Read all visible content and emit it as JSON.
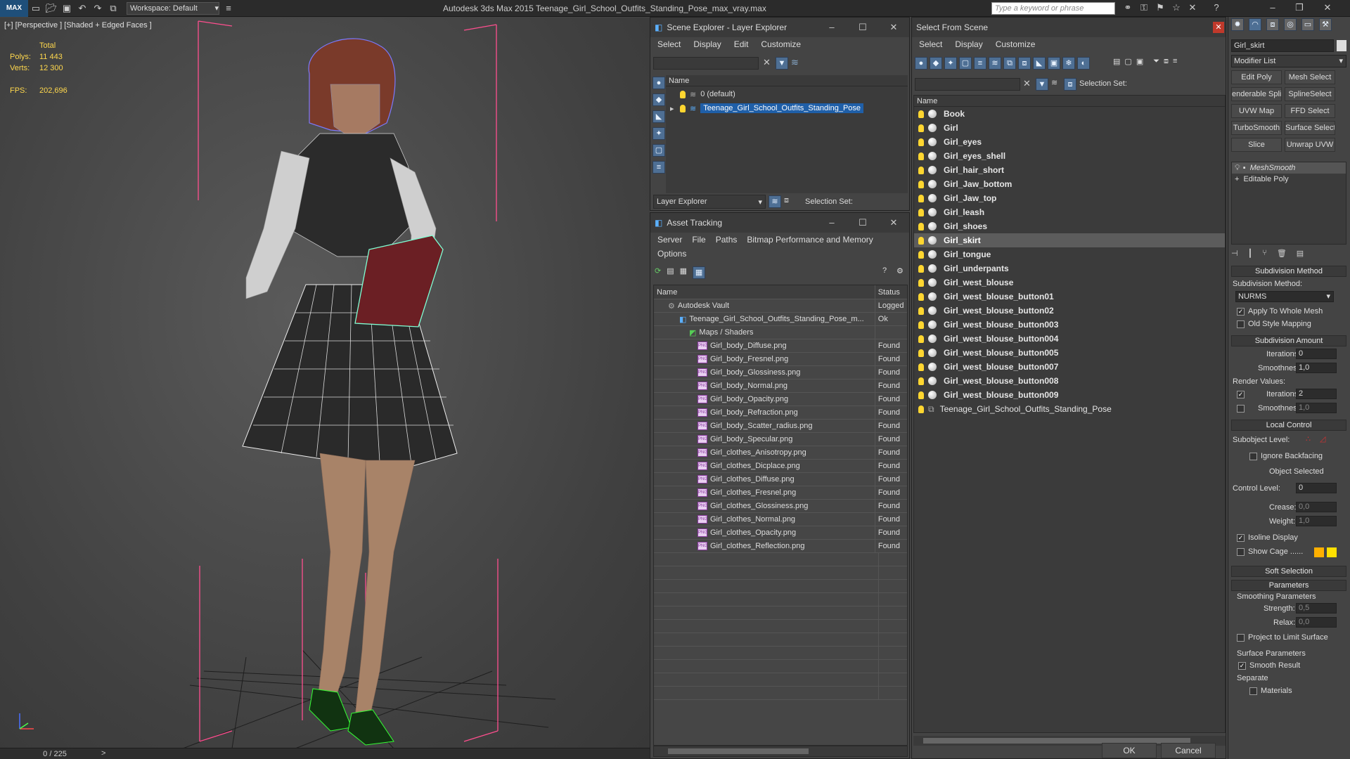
{
  "app": {
    "title": "Autodesk 3ds Max  2015     Teenage_Girl_School_Outfits_Standing_Pose_max_vray.max",
    "logo": "MAX",
    "workspace": "Workspace: Default",
    "search_placeholder": "Type a keyword or phrase"
  },
  "viewport": {
    "label": "[+] [Perspective ] [Shaded + Edged Faces ]",
    "stats": {
      "total_label": "Total",
      "polys_label": "Polys:",
      "polys": "11 443",
      "verts_label": "Verts:",
      "verts": "12 300",
      "fps_label": "FPS:",
      "fps": "202,696"
    },
    "frame": "0 / 225",
    "axis_labels": {
      "x": "x",
      "y": "y",
      "z": "z"
    }
  },
  "scene_explorer": {
    "title": "Scene Explorer - Layer Explorer",
    "menu": [
      "Select",
      "Display",
      "Edit",
      "Customize"
    ],
    "col_name": "Name",
    "items": [
      "0 (default)",
      "Teenage_Girl_School_Outfits_Standing_Pose"
    ],
    "footer_dropdown": "Layer Explorer",
    "selection_set": "Selection Set:"
  },
  "asset_tracking": {
    "title": "Asset Tracking",
    "menu": [
      "Server",
      "File",
      "Paths",
      "Bitmap Performance and Memory"
    ],
    "menu2": "Options",
    "col_name": "Name",
    "col_status": "Status",
    "rows": [
      {
        "name": "Autodesk Vault",
        "status": "Logged",
        "level": 1,
        "kind": "vault"
      },
      {
        "name": "Teenage_Girl_School_Outfits_Standing_Pose_m...",
        "status": "Ok",
        "level": 2,
        "kind": "file"
      },
      {
        "name": "Maps / Shaders",
        "status": "",
        "level": 3,
        "kind": "maps"
      },
      {
        "name": "Girl_body_Diffuse.png",
        "status": "Found",
        "level": 4,
        "kind": "png"
      },
      {
        "name": "Girl_body_Fresnel.png",
        "status": "Found",
        "level": 4,
        "kind": "png"
      },
      {
        "name": "Girl_body_Glossiness.png",
        "status": "Found",
        "level": 4,
        "kind": "png"
      },
      {
        "name": "Girl_body_Normal.png",
        "status": "Found",
        "level": 4,
        "kind": "png"
      },
      {
        "name": "Girl_body_Opacity.png",
        "status": "Found",
        "level": 4,
        "kind": "png"
      },
      {
        "name": "Girl_body_Refraction.png",
        "status": "Found",
        "level": 4,
        "kind": "png"
      },
      {
        "name": "Girl_body_Scatter_radius.png",
        "status": "Found",
        "level": 4,
        "kind": "png"
      },
      {
        "name": "Girl_body_Specular.png",
        "status": "Found",
        "level": 4,
        "kind": "png"
      },
      {
        "name": "Girl_clothes_Anisotropy.png",
        "status": "Found",
        "level": 4,
        "kind": "png"
      },
      {
        "name": "Girl_clothes_Dicplace.png",
        "status": "Found",
        "level": 4,
        "kind": "png"
      },
      {
        "name": "Girl_clothes_Diffuse.png",
        "status": "Found",
        "level": 4,
        "kind": "png"
      },
      {
        "name": "Girl_clothes_Fresnel.png",
        "status": "Found",
        "level": 4,
        "kind": "png"
      },
      {
        "name": "Girl_clothes_Glossiness.png",
        "status": "Found",
        "level": 4,
        "kind": "png"
      },
      {
        "name": "Girl_clothes_Normal.png",
        "status": "Found",
        "level": 4,
        "kind": "png"
      },
      {
        "name": "Girl_clothes_Opacity.png",
        "status": "Found",
        "level": 4,
        "kind": "png"
      },
      {
        "name": "Girl_clothes_Reflection.png",
        "status": "Found",
        "level": 4,
        "kind": "png"
      }
    ]
  },
  "select_from_scene": {
    "title": "Select From Scene",
    "menu": [
      "Select",
      "Display",
      "Customize"
    ],
    "selection_set": "Selection Set:",
    "col_name": "Name",
    "items": [
      "Book",
      "Girl",
      "Girl_eyes",
      "Girl_eyes_shell",
      "Girl_hair_short",
      "Girl_Jaw_bottom",
      "Girl_Jaw_top",
      "Girl_leash",
      "Girl_shoes",
      "Girl_skirt",
      "Girl_tongue",
      "Girl_underpants",
      "Girl_west_blouse",
      "Girl_west_blouse_button01",
      "Girl_west_blouse_button02",
      "Girl_west_blouse_button003",
      "Girl_west_blouse_button004",
      "Girl_west_blouse_button005",
      "Girl_west_blouse_button007",
      "Girl_west_blouse_button008",
      "Girl_west_blouse_button009"
    ],
    "selected": "Girl_skirt",
    "group_item": "Teenage_Girl_School_Outfits_Standing_Pose",
    "ok": "OK",
    "cancel": "Cancel"
  },
  "command_panel": {
    "object_name": "Girl_skirt",
    "modifier_list": "Modifier List",
    "buttons": [
      "Edit Poly",
      "Mesh Select",
      "enderable Splir",
      "SplineSelect",
      "UVW Map",
      "FFD Select",
      "TurboSmooth",
      "Surface Select",
      "Slice",
      "Unwrap UVW"
    ],
    "stack": [
      "MeshSmooth",
      "Editable Poly"
    ],
    "rollouts": {
      "subdivision_method": "Subdivision Method",
      "subdivision_method_label": "Subdivision Method:",
      "method_value": "NURMS",
      "apply_whole_mesh": "Apply To Whole Mesh",
      "old_style": "Old Style Mapping",
      "subdivision_amount": "Subdivision Amount",
      "iterations_label": "Iterations:",
      "iterations": "0",
      "smoothness_label": "Smoothness:",
      "smoothness": "1,0",
      "render_values": "Render Values:",
      "render_iterations": "2",
      "render_smoothness": "1,0",
      "local_control": "Local Control",
      "subobject_level": "Subobject Level:",
      "ignore_backfacing": "Ignore Backfacing",
      "object_selected": "Object Selected",
      "control_level_label": "Control Level:",
      "control_level": "0",
      "crease_label": "Crease:",
      "crease": "0,0",
      "weight_label": "Weight:",
      "weight": "1,0",
      "isoline_display": "Isoline Display",
      "show_cage": "Show Cage ......",
      "soft_selection": "Soft Selection",
      "parameters": "Parameters",
      "smoothing_params": "Smoothing Parameters",
      "strength_label": "Strength:",
      "strength": "0,5",
      "relax_label": "Relax:",
      "relax": "0,0",
      "project_limit": "Project to Limit Surface",
      "surface_params": "Surface Parameters",
      "smooth_result": "Smooth Result",
      "separate": "Separate",
      "materials": "Materials"
    }
  },
  "colors": {
    "accent_blue": "#2f6fb0",
    "selected_row": "#1f5fa8",
    "bulb": "#ffd630",
    "cage1": "#ffb000",
    "cage2": "#ffe000"
  }
}
